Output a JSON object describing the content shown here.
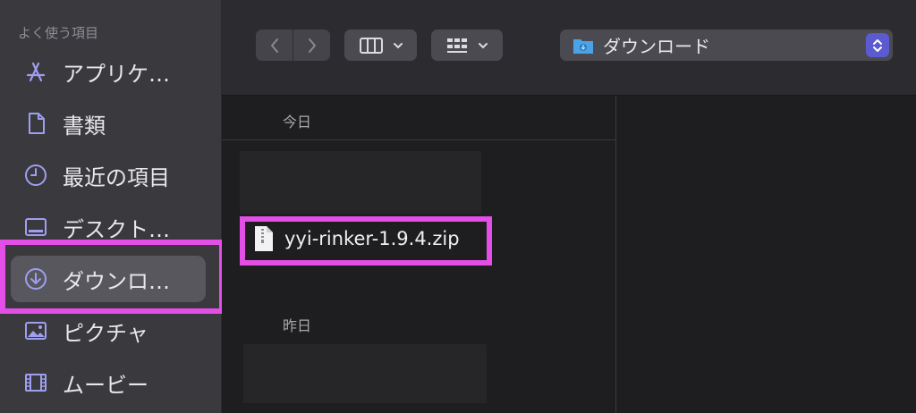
{
  "sidebar": {
    "heading": "よく使う項目",
    "items": [
      {
        "label": "アプリケ…",
        "icon": "applications-icon"
      },
      {
        "label": "書類",
        "icon": "document-icon"
      },
      {
        "label": "最近の項目",
        "icon": "clock-icon"
      },
      {
        "label": "デスクト…",
        "icon": "desktop-icon"
      },
      {
        "label": "ダウンロ…",
        "icon": "download-icon",
        "selected": true
      },
      {
        "label": "ピクチャ",
        "icon": "photo-icon"
      },
      {
        "label": "ムービー",
        "icon": "film-icon"
      }
    ]
  },
  "toolbar": {
    "back_icon": "chevron-left-icon",
    "forward_icon": "chevron-right-icon",
    "view_icon": "column-view-icon",
    "group_icon": "grid-group-icon",
    "location": "ダウンロード"
  },
  "browser": {
    "today_label": "今日",
    "yesterday_label": "昨日",
    "file_name": "yyi-rinker-1.9.4.zip"
  },
  "colors": {
    "highlight": "#e34ee7",
    "accent": "#5b5ad0",
    "folder": "#4aa3e6"
  }
}
